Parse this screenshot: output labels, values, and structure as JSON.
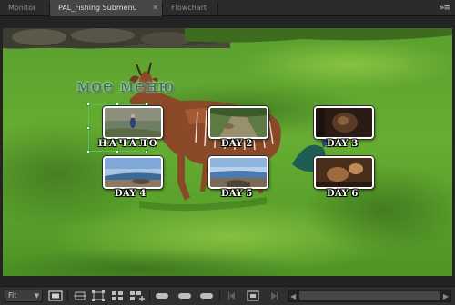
{
  "tabs": [
    {
      "label": "Monitor",
      "active": false
    },
    {
      "label": "PAL_Fishing Submenu",
      "active": true
    },
    {
      "label": "Flowchart",
      "active": false
    }
  ],
  "panel_menu_icon": "double-chevron-menu-icon",
  "menu": {
    "title": "мое меню",
    "buttons": [
      {
        "label": "НАЧАЛО",
        "selected": true
      },
      {
        "label": "DAY 2"
      },
      {
        "label": "DAY 3"
      },
      {
        "label": "DAY 4"
      },
      {
        "label": "DAY 5"
      },
      {
        "label": "DAY 6"
      }
    ]
  },
  "toolbar": {
    "zoom_value": "Fit",
    "icons": [
      "safe-margins-icon",
      "fit-to-frame-icon",
      "show-handles-icon",
      "layout-icon",
      "add-layout-icon",
      "button-shape-1-icon",
      "button-shape-2-icon",
      "button-shape-3-icon",
      "previous-icon",
      "preview-icon",
      "next-icon"
    ]
  },
  "colors": {
    "accent_selection": "#56c25c",
    "title_green": "#2f7a4c",
    "panel_bg": "#232323"
  }
}
